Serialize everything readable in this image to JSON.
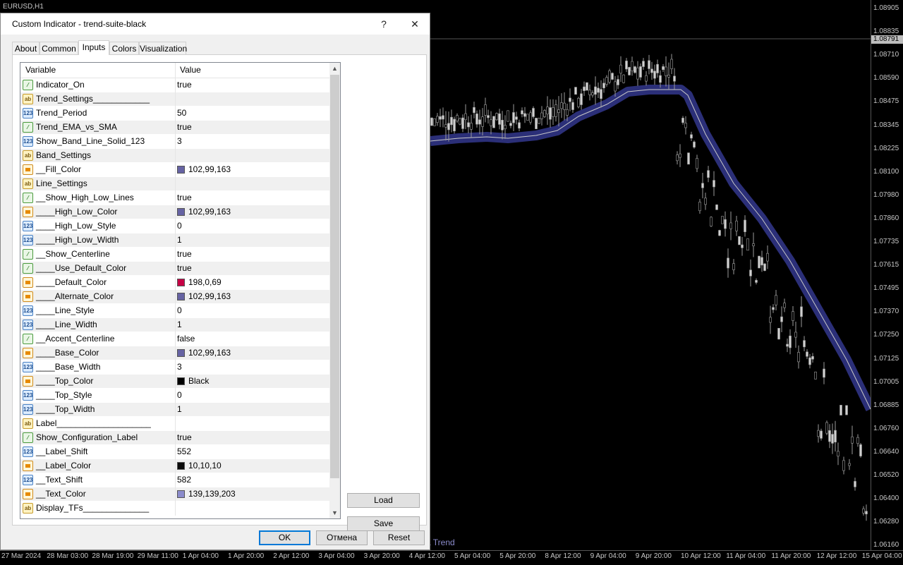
{
  "chart": {
    "symbol": "EURUSD,H1",
    "current_price": "1.08791",
    "price_labels": [
      "1.08905",
      "1.08835",
      "1.08710",
      "1.08590",
      "1.08475",
      "1.08345",
      "1.08225",
      "1.08100",
      "1.07980",
      "1.07860",
      "1.07735",
      "1.07615",
      "1.07495",
      "1.07370",
      "1.07250",
      "1.07125",
      "1.07005",
      "1.06885",
      "1.06760",
      "1.06640",
      "1.06520",
      "1.06400",
      "1.06280",
      "1.06160"
    ],
    "time_labels": [
      "27 Mar 2024",
      "28 Mar 03:00",
      "28 Mar 19:00",
      "29 Mar 11:00",
      "1 Apr 04:00",
      "1 Apr 20:00",
      "2 Apr 12:00",
      "3 Apr 04:00",
      "3 Apr 20:00",
      "4 Apr 12:00",
      "5 Apr 04:00",
      "5 Apr 20:00",
      "8 Apr 12:00",
      "9 Apr 04:00",
      "9 Apr 20:00",
      "10 Apr 12:00",
      "11 Apr 04:00",
      "11 Apr 20:00",
      "12 Apr 12:00",
      "15 Apr 04:00"
    ],
    "caption": "a Trend",
    "band_color": "#2b2f78"
  },
  "dialog": {
    "title": "Custom Indicator - trend-suite-black",
    "help": "?",
    "close": "✕",
    "tabs": [
      "About",
      "Common",
      "Inputs",
      "Colors",
      "Visualization"
    ],
    "active_tab": "Inputs",
    "headers": {
      "variable": "Variable",
      "value": "Value"
    },
    "rows": [
      {
        "icon": "bool",
        "name": "Indicator_On",
        "value": "true"
      },
      {
        "icon": "str",
        "name": "Trend_Settings____________",
        "value": ""
      },
      {
        "icon": "int",
        "name": "Trend_Period",
        "value": "50"
      },
      {
        "icon": "bool",
        "name": "Trend_EMA_vs_SMA",
        "value": "true"
      },
      {
        "icon": "int",
        "name": "Show_Band_Line_Solid_123",
        "value": "3"
      },
      {
        "icon": "str",
        "name": "Band_Settings",
        "value": ""
      },
      {
        "icon": "col",
        "name": "__Fill_Color",
        "value": "102,99,163",
        "swatch": "#6663a3"
      },
      {
        "icon": "str",
        "name": "Line_Settings",
        "value": ""
      },
      {
        "icon": "bool",
        "name": "__Show_High_Low_Lines",
        "value": "true"
      },
      {
        "icon": "col",
        "name": "____High_Low_Color",
        "value": "102,99,163",
        "swatch": "#6663a3"
      },
      {
        "icon": "int",
        "name": "____High_Low_Style",
        "value": "0"
      },
      {
        "icon": "int",
        "name": "____High_Low_Width",
        "value": "1"
      },
      {
        "icon": "bool",
        "name": "__Show_Centerline",
        "value": "true"
      },
      {
        "icon": "bool",
        "name": "____Use_Default_Color",
        "value": "true"
      },
      {
        "icon": "col",
        "name": "____Default_Color",
        "value": "198,0,69",
        "swatch": "#c60045"
      },
      {
        "icon": "col",
        "name": "____Alternate_Color",
        "value": "102,99,163",
        "swatch": "#6663a3"
      },
      {
        "icon": "int",
        "name": "____Line_Style",
        "value": "0"
      },
      {
        "icon": "int",
        "name": "____Line_Width",
        "value": "1"
      },
      {
        "icon": "bool",
        "name": "__Accent_Centerline",
        "value": "false"
      },
      {
        "icon": "col",
        "name": "____Base_Color",
        "value": "102,99,163",
        "swatch": "#6663a3"
      },
      {
        "icon": "int",
        "name": "____Base_Width",
        "value": "3"
      },
      {
        "icon": "col",
        "name": "____Top_Color",
        "value": "Black",
        "swatch": "#000000"
      },
      {
        "icon": "int",
        "name": "____Top_Style",
        "value": "0"
      },
      {
        "icon": "int",
        "name": "____Top_Width",
        "value": "1"
      },
      {
        "icon": "str",
        "name": "Label____________________",
        "value": ""
      },
      {
        "icon": "bool",
        "name": "Show_Configuration_Label",
        "value": "true"
      },
      {
        "icon": "int",
        "name": "__Label_Shift",
        "value": "552"
      },
      {
        "icon": "col",
        "name": "__Label_Color",
        "value": "10,10,10",
        "swatch": "#0a0a0a"
      },
      {
        "icon": "int",
        "name": "__Text_Shift",
        "value": "582"
      },
      {
        "icon": "col",
        "name": "__Text_Color",
        "value": "139,139,203",
        "swatch": "#8b8bcb"
      },
      {
        "icon": "str",
        "name": "Display_TFs______________",
        "value": ""
      }
    ],
    "buttons": {
      "load": "Load",
      "save": "Save",
      "ok": "OK",
      "cancel": "Отмена",
      "reset": "Reset"
    }
  }
}
